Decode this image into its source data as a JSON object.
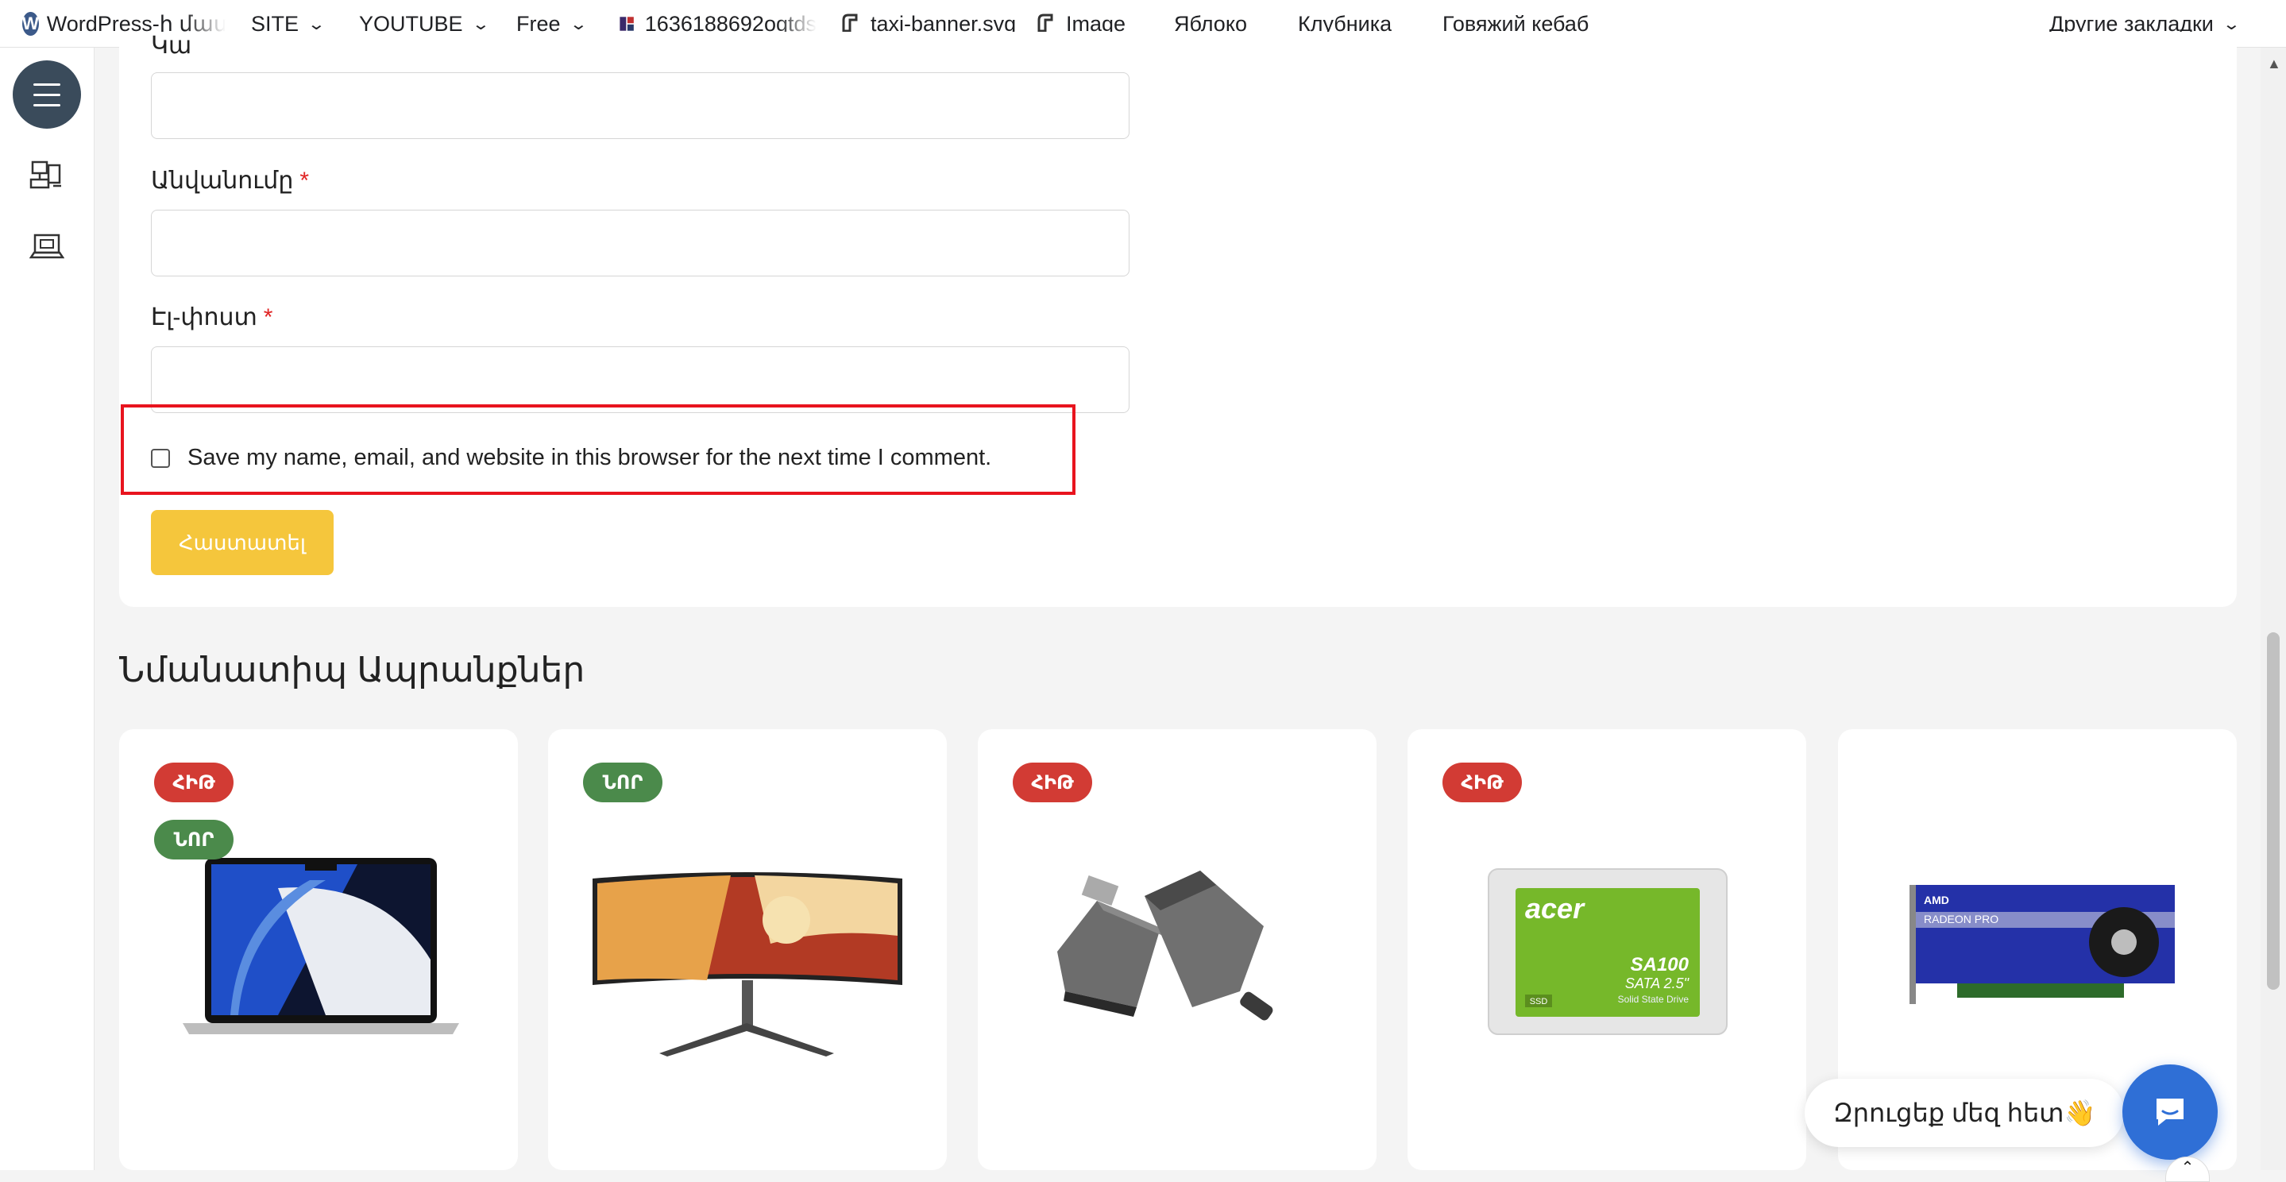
{
  "bookmarks": {
    "items": [
      {
        "label": "WordPress-ի մաս",
        "icon": "wordpress-icon"
      },
      {
        "label": "SITE",
        "dropdown": true
      },
      {
        "label": "YOUTUBE",
        "dropdown": true
      },
      {
        "label": "Free",
        "dropdown": true
      },
      {
        "label": "1636188692ogtds",
        "icon": "site-favicon"
      },
      {
        "label": "taxi-banner.svg",
        "icon": "site-favicon"
      },
      {
        "label": "Image",
        "icon": "site-favicon"
      },
      {
        "label": "Яблоко"
      },
      {
        "label": "Клубника"
      },
      {
        "label": "Говяжий кебаб"
      }
    ],
    "other_label": "Другие закладки"
  },
  "sidebar": {
    "menu_icon": "hamburger-menu-icon",
    "icons": [
      "computer-network-icon",
      "laptop-icon"
    ]
  },
  "form": {
    "partial_label": "Կա",
    "fields": [
      {
        "label": "Անվանումը",
        "required_mark": "*"
      },
      {
        "label": "Էլ-փոստ",
        "required_mark": "*"
      }
    ],
    "consent_text": "Save my name, email, and website in this browser for the next time I comment.",
    "consent_checked": false,
    "submit_label": "Հաստատել",
    "accent_color": "#f5c63c",
    "highlight_color": "#e8141e"
  },
  "related": {
    "title": "Նմանատիպ Ապրանքներ",
    "products": [
      {
        "badges": [
          {
            "text": "ՀԻԹ",
            "kind": "hit"
          },
          {
            "text": "ՆՈՐ",
            "kind": "new"
          }
        ],
        "image": "laptop-image"
      },
      {
        "badges": [
          {
            "text": "ՆՈՐ",
            "kind": "new"
          }
        ],
        "image": "curved-monitor-image"
      },
      {
        "badges": [
          {
            "text": "ՀԻԹ",
            "kind": "hit"
          }
        ],
        "image": "card-reader-image"
      },
      {
        "badges": [
          {
            "text": "ՀԻԹ",
            "kind": "hit"
          }
        ],
        "image": "ssd-image",
        "ssd_brand": "acer",
        "ssd_model": "SA100",
        "ssd_spec": "SATA 2.5\"",
        "ssd_sub": "Solid State Drive",
        "ssd_tag": "SSD"
      },
      {
        "badges": [],
        "image": "gpu-image",
        "gpu_text_1": "AMD",
        "gpu_text_2": "RADEON PRO"
      }
    ],
    "badge_colors": {
      "hit": "#d23b34",
      "new": "#4b8a4b"
    }
  },
  "chat": {
    "bubble_text": "Զրուցեք մեզ հետ",
    "bubble_emoji": "👋",
    "button_color": "#2f6fd6"
  }
}
